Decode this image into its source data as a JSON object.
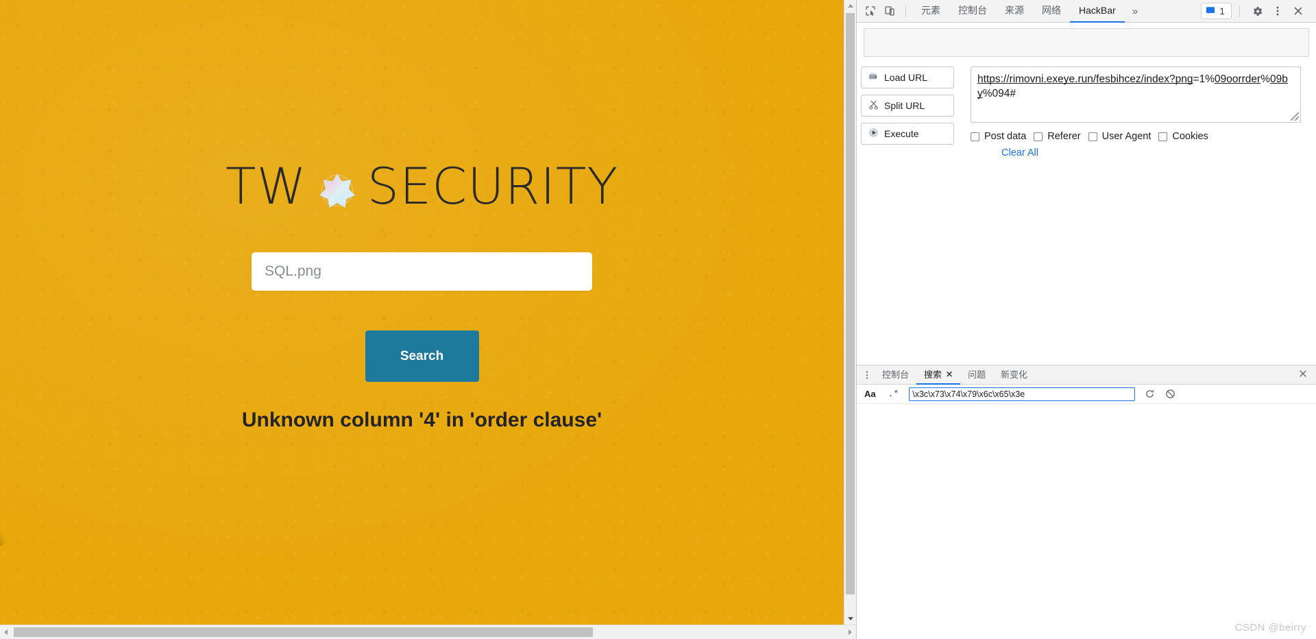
{
  "page": {
    "brand": {
      "prefix": "TW",
      "suffix": "SECURITY",
      "logo_icon": "starburst-logo-icon"
    },
    "search": {
      "value": "SQL.png",
      "placeholder": "SQL.png"
    },
    "search_button_label": "Search",
    "error_message": "Unknown column '4' in 'order clause'",
    "background_color": "#e8a80c",
    "button_color": "#1d7a9c",
    "decoration": "two-grey-pencils"
  },
  "devtools": {
    "toolbar": {
      "inspect_icon": "inspect-element-icon",
      "device_icon": "device-toolbar-icon",
      "settings_icon": "gear-icon",
      "menu_icon": "vertical-dots-icon",
      "close_icon": "close-icon",
      "message_icon": "message-icon",
      "message_count": "1",
      "more_tabs_label": "»"
    },
    "tabs": [
      {
        "label": "元素",
        "active": false
      },
      {
        "label": "控制台",
        "active": false
      },
      {
        "label": "来源",
        "active": false
      },
      {
        "label": "网络",
        "active": false
      },
      {
        "label": "HackBar",
        "active": true
      }
    ],
    "hackbar": {
      "buttons": [
        {
          "label": "Load URL",
          "icon": "load-url-icon"
        },
        {
          "label": "Split URL",
          "icon": "scissors-icon"
        },
        {
          "label": "Execute",
          "icon": "play-icon"
        }
      ],
      "url_value": "https://rimovni.exeye.run/fesbihcez/index?png=1%09oorrder%09by%094#",
      "url_parts": {
        "scheme": "https",
        "sep1": "://",
        "host": "rimovni.exeye.run",
        "slash1": "/",
        "path": "fesbihcez",
        "slash2": "/",
        "page": "index?",
        "param": "png",
        "rest": "=1%",
        "t1": "09oorrder",
        "pct": "%",
        "t2": "09by",
        "tail": "%094#"
      },
      "options": [
        {
          "label": "Post data",
          "checked": false
        },
        {
          "label": "Referer",
          "checked": false
        },
        {
          "label": "User Agent",
          "checked": false
        },
        {
          "label": "Cookies",
          "checked": false
        }
      ],
      "clear_all_label": "Clear All"
    },
    "drawer": {
      "menu_icon": "vertical-dots-icon",
      "tabs": [
        {
          "label": "控制台",
          "active": false,
          "closable": false
        },
        {
          "label": "搜索",
          "active": true,
          "closable": true,
          "close_label": "✕"
        },
        {
          "label": "问题",
          "active": false,
          "closable": false
        },
        {
          "label": "新变化",
          "active": false,
          "closable": false
        }
      ],
      "close_icon": "close-icon",
      "search": {
        "match_case_label": "Aa",
        "regex_label": ".*",
        "query": "\\x3c\\x73\\x74\\x79\\x6c\\x65\\x3e",
        "refresh_icon": "refresh-icon",
        "clear_icon": "clear-icon"
      }
    }
  },
  "watermark": "CSDN @beirry"
}
